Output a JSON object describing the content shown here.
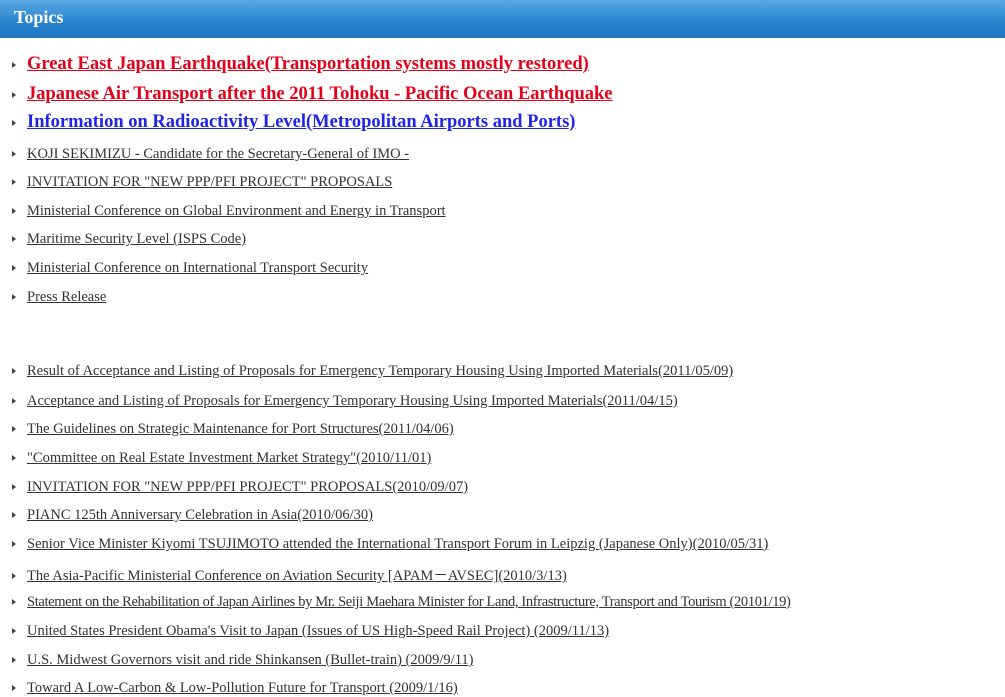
{
  "header": {
    "title": "Topics"
  },
  "colors": {
    "header_blue": "#2b86cf",
    "link_red": "#e40018",
    "link_blue": "#1f24e6"
  },
  "featured": [
    {
      "label": "Great East Japan Earthquake(Transportation systems mostly restored)",
      "style": "red"
    },
    {
      "label": "Japanese Air Transport after the 2011 Tohoku - Pacific Ocean Earthquake",
      "style": "red"
    },
    {
      "label": "Information on Radioactivity Level(Metropolitan Airports and Ports)",
      "style": "blue"
    }
  ],
  "topics": [
    "KOJI SEKIMIZU - Candidate for the Secretary-General of IMO -",
    "INVITATION FOR \"NEW PPP/PFI PROJECT\" PROPOSALS",
    "Ministerial Conference on Global Environment and Energy in Transport",
    "Maritime Security Level (ISPS Code)",
    "Ministerial Conference on International Transport Security",
    "Press Release"
  ],
  "news": [
    "Result of Acceptance and Listing of Proposals for Emergency Temporary Housing Using Imported Materials(2011/05/09)",
    "Acceptance and Listing of Proposals for Emergency Temporary Housing Using Imported Materials(2011/04/15)",
    "The Guidelines on Strategic Maintenance for Port Structures(2011/04/06)",
    "\"Committee on Real Estate Investment Market Strategy\"(2010/11/01)",
    "INVITATION FOR \"NEW PPP/PFI PROJECT\" PROPOSALS(2010/09/07)",
    "PIANC 125th Anniversary Celebration in Asia(2010/06/30)",
    "Senior Vice Minister Kiyomi TSUJIMOTO attended the International Transport Forum in Leipzig (Japanese Only)(2010/05/31)",
    "The Asia-Pacific Ministerial Conference on Aviation Security [APAM－AVSEC](2010/3/13)",
    "Statement on the Rehabilitation of Japan Airlines by Mr. Seiji Maehara Minister for Land, Infrastructure, Transport and Tourism (20101/19)",
    "United States President Obama's Visit to Japan (Issues of US High-Speed Rail Project) (2009/11/13)",
    "U.S. Midwest Governors visit and ride Shinkansen (Bullet-train) (2009/9/11)",
    "Toward A Low-Carbon & Low-Pollution Future for Transport (2009/1/16)"
  ]
}
